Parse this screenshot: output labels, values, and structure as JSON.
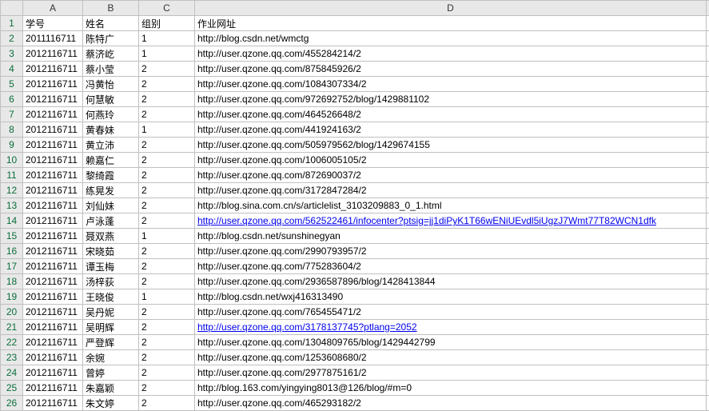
{
  "columns": [
    "A",
    "B",
    "C",
    "D"
  ],
  "headers": {
    "col_a": "学号",
    "col_b": "姓名",
    "col_c": "组别",
    "col_d": "作业网址"
  },
  "rows": [
    {
      "n": 1,
      "a": "学号",
      "b": "姓名",
      "c": "组别",
      "d": "作业网址",
      "link": false
    },
    {
      "n": 2,
      "a": "2011116711",
      "b": "陈特广",
      "c": "1",
      "d": "http://blog.csdn.net/wmctg",
      "link": false
    },
    {
      "n": 3,
      "a": "2012116711",
      "b": "蔡济屹",
      "c": "1",
      "d": "http://user.qzone.qq.com/455284214/2",
      "link": false
    },
    {
      "n": 4,
      "a": "2012116711",
      "b": "蔡小莹",
      "c": "2",
      "d": "http://user.qzone.qq.com/875845926/2",
      "link": false
    },
    {
      "n": 5,
      "a": "2012116711",
      "b": "冯黄怡",
      "c": "2",
      "d": "http://user.qzone.qq.com/1084307334/2",
      "link": false
    },
    {
      "n": 6,
      "a": "2012116711",
      "b": "何慧敏",
      "c": "2",
      "d": "http://user.qzone.qq.com/972692752/blog/1429881102",
      "link": false
    },
    {
      "n": 7,
      "a": "2012116711",
      "b": "何燕玲",
      "c": "2",
      "d": "http://user.qzone.qq.com/464526648/2",
      "link": false
    },
    {
      "n": 8,
      "a": "2012116711",
      "b": "黄春妹",
      "c": "1",
      "d": "http://user.qzone.qq.com/441924163/2",
      "link": false
    },
    {
      "n": 9,
      "a": "2012116711",
      "b": "黄立沛",
      "c": "2",
      "d": "http://user.qzone.qq.com/505979562/blog/1429674155",
      "link": false
    },
    {
      "n": 10,
      "a": "2012116711",
      "b": "赖嘉仁",
      "c": "2",
      "d": "http://user.qzone.qq.com/1006005105/2",
      "link": false
    },
    {
      "n": 11,
      "a": "2012116711",
      "b": "黎绮霞",
      "c": "2",
      "d": "http://user.qzone.qq.com/872690037/2",
      "link": false
    },
    {
      "n": 12,
      "a": "2012116711",
      "b": "练晃发",
      "c": "2",
      "d": "http://user.qzone.qq.com/3172847284/2",
      "link": false
    },
    {
      "n": 13,
      "a": "2012116711",
      "b": "刘仙妹",
      "c": "2",
      "d": "http://blog.sina.com.cn/s/articlelist_3103209883_0_1.html",
      "link": false
    },
    {
      "n": 14,
      "a": "2012116711",
      "b": "卢泳蓬",
      "c": "2",
      "d": "http://user.qzone.qq.com/562522461/infocenter?ptsig=jj1diPyK1T66wENiUEvdl5iUgzJ7Wmt77T82WCN1dfk",
      "link": "blue"
    },
    {
      "n": 15,
      "a": "2012116711",
      "b": "聂双燕",
      "c": "1",
      "d": "http://blog.csdn.net/sunshinegyan",
      "link": false
    },
    {
      "n": 16,
      "a": "2012116711",
      "b": "宋晓茹",
      "c": "2",
      "d": "http://user.qzone.qq.com/2990793957/2",
      "link": false
    },
    {
      "n": 17,
      "a": "2012116711",
      "b": "谭玉梅",
      "c": "2",
      "d": "http://user.qzone.qq.com/775283604/2",
      "link": false
    },
    {
      "n": 18,
      "a": "2012116711",
      "b": "汤梓荻",
      "c": "2",
      "d": "http://user.qzone.qq.com/2936587896/blog/1428413844",
      "link": false
    },
    {
      "n": 19,
      "a": "2012116711",
      "b": "王晓俊",
      "c": "1",
      "d": "http://blog.csdn.net/wxj416313490",
      "link": false
    },
    {
      "n": 20,
      "a": "2012116711",
      "b": "吴丹妮",
      "c": "2",
      "d": "http://user.qzone.qq.com/765455471/2",
      "link": false
    },
    {
      "n": 21,
      "a": "2012116711",
      "b": "吴明辉",
      "c": "2",
      "d": "http://user.qzone.qq.com/3178137745?ptlang=2052",
      "link": "blue"
    },
    {
      "n": 22,
      "a": "2012116711",
      "b": "严登辉",
      "c": "2",
      "d": "http://user.qzone.qq.com/1304809765/blog/1429442799",
      "link": false
    },
    {
      "n": 23,
      "a": "2012116711",
      "b": "余婉",
      "c": "2",
      "d": "http://user.qzone.qq.com/1253608680/2",
      "link": false
    },
    {
      "n": 24,
      "a": "2012116711",
      "b": "曾婷",
      "c": "2",
      "d": "http://user.qzone.qq.com/2977875161/2",
      "link": false
    },
    {
      "n": 25,
      "a": "2012116711",
      "b": "朱嘉颖",
      "c": "2",
      "d": "http://blog.163.com/yingying8013@126/blog/#m=0",
      "link": false
    },
    {
      "n": 26,
      "a": "2012116711",
      "b": "朱文婷",
      "c": "2",
      "d": "http://user.qzone.qq.com/465293182/2",
      "link": false
    }
  ]
}
